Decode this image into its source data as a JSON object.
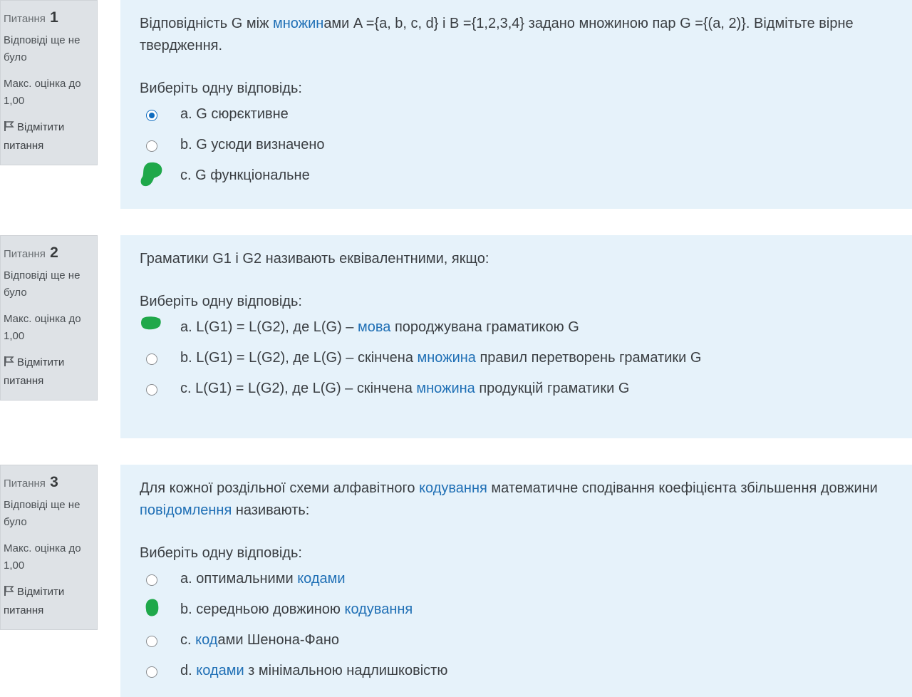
{
  "questions": [
    {
      "info": {
        "word": "Питання",
        "num": "1",
        "state": "Відповіді ще не було",
        "grade": "Макс. оцінка до 1,00",
        "flag": "Відмітити питання"
      },
      "text": [
        "Відповідність G між ",
        "множин",
        "ами A ={a, b, c, d} і B ={1,2,3,4} задано множиною пар G ={(a, 2)}. Відмітьте вірне твердження."
      ],
      "prompt": "Виберіть одну відповідь:",
      "answers": [
        {
          "letter": "a.",
          "parts": [
            "G сюрєктивне"
          ],
          "links": [],
          "selected": true,
          "marker": "none"
        },
        {
          "letter": "b.",
          "parts": [
            "G усюди визначено"
          ],
          "links": [],
          "selected": false,
          "marker": "none"
        },
        {
          "letter": "c.",
          "parts": [
            "G функціональне"
          ],
          "links": [],
          "selected": false,
          "marker": "green"
        }
      ]
    },
    {
      "info": {
        "word": "Питання",
        "num": "2",
        "state": "Відповіді ще не було",
        "grade": "Макс. оцінка до 1,00",
        "flag": "Відмітити питання"
      },
      "text": [
        "Граматики G1 і G2 називають еквівалентними, якщо:"
      ],
      "prompt": "Виберіть одну відповідь:",
      "answers": [
        {
          "letter": "a.",
          "parts": [
            "L(G1) = L(G2), де L(G) – ",
            "мова",
            " породжувана граматикою G"
          ],
          "links": [
            1
          ],
          "selected": false,
          "marker": "green"
        },
        {
          "letter": "b.",
          "parts": [
            "L(G1) = L(G2), де L(G) – скінчена ",
            "множина",
            " правил перетворень граматики G"
          ],
          "links": [
            1
          ],
          "selected": false,
          "marker": "none"
        },
        {
          "letter": "c.",
          "parts": [
            "L(G1) = L(G2), де L(G) – скінчена ",
            "множина",
            " продукцій граматики G"
          ],
          "links": [
            1
          ],
          "selected": false,
          "marker": "none"
        }
      ]
    },
    {
      "info": {
        "word": "Питання",
        "num": "3",
        "state": "Відповіді ще не було",
        "grade": "Макс. оцінка до 1,00",
        "flag": "Відмітити питання"
      },
      "text": [
        "Для кожної роздільної схеми алфавітного ",
        "кодування",
        " математичне сподівання коефіцієнта збільшення довжини ",
        "повідомлення",
        " називають:"
      ],
      "prompt": "Виберіть одну відповідь:",
      "answers": [
        {
          "letter": "a.",
          "parts": [
            "оптимальними ",
            "кодами"
          ],
          "links": [
            1
          ],
          "selected": false,
          "marker": "none"
        },
        {
          "letter": "b.",
          "parts": [
            "середньою довжиною ",
            "кодування"
          ],
          "links": [
            1
          ],
          "selected": false,
          "marker": "green"
        },
        {
          "letter": "c.",
          "parts": [
            "",
            "код",
            "ами Шенона-Фано"
          ],
          "links": [
            1
          ],
          "selected": false,
          "marker": "none"
        },
        {
          "letter": "d.",
          "parts": [
            "",
            "кодами",
            " з мінімальною надлишковістю"
          ],
          "links": [
            1
          ],
          "selected": false,
          "marker": "none"
        }
      ]
    }
  ]
}
